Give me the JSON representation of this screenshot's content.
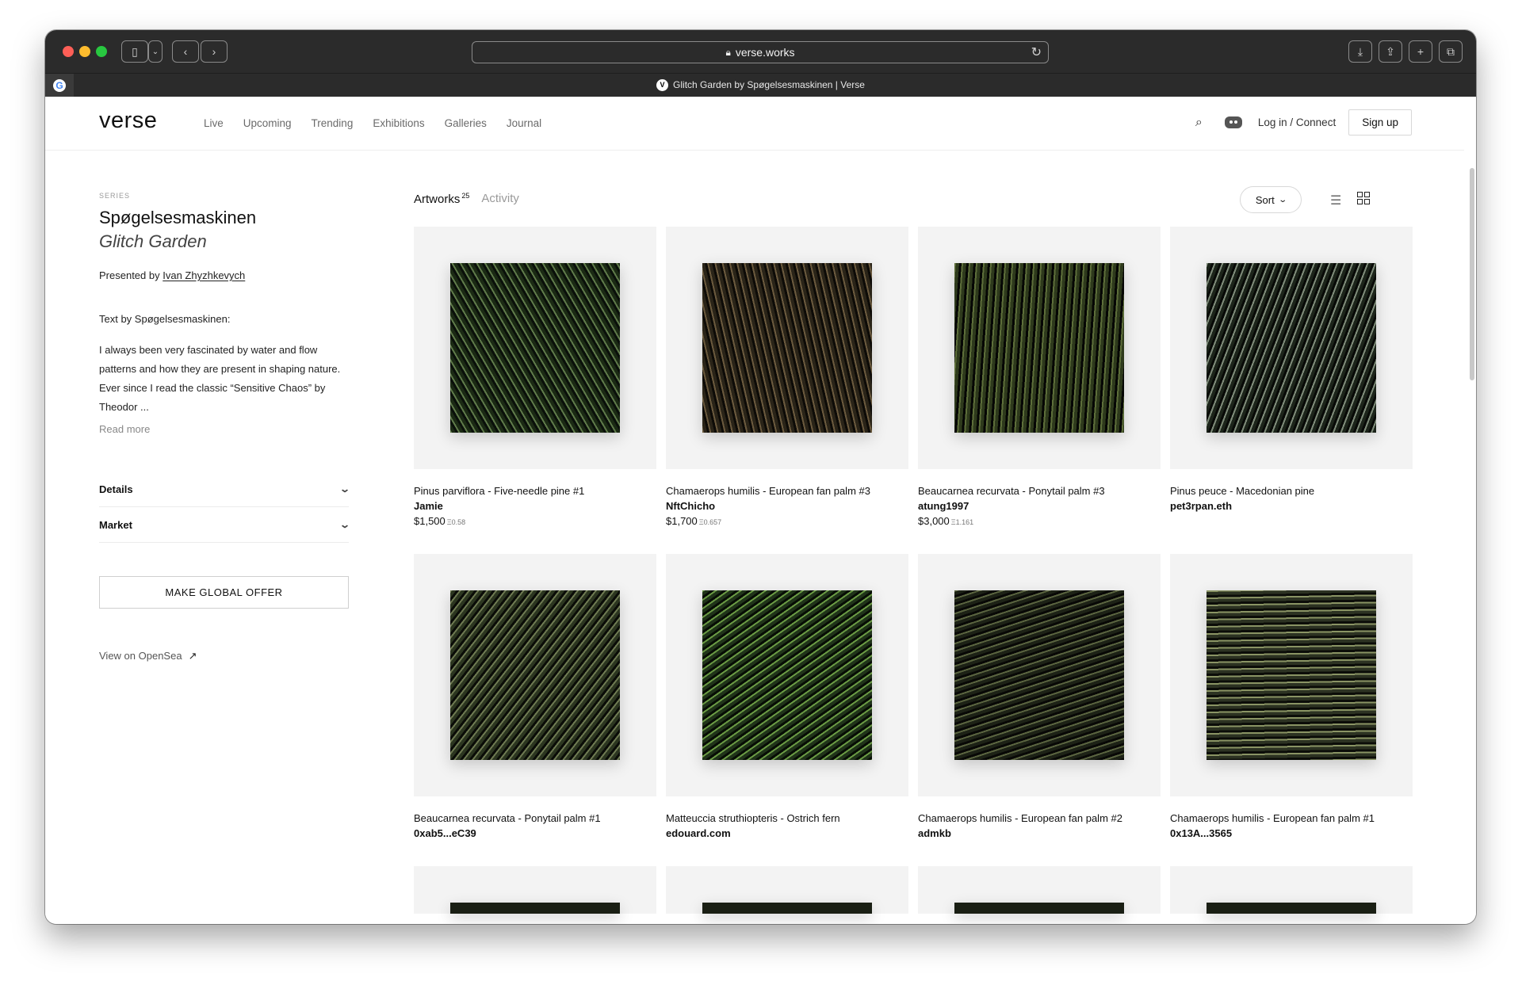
{
  "browser": {
    "url": "verse.works",
    "tab_title": "Glitch Garden by Spøgelsesmaskinen | Verse"
  },
  "nav": {
    "logo": "verse",
    "links": [
      "Live",
      "Upcoming",
      "Trending",
      "Exhibitions",
      "Galleries",
      "Journal"
    ],
    "login": "Log in / Connect",
    "signup": "Sign up"
  },
  "sidebar": {
    "label": "SERIES",
    "title": "Spøgelsesmaskinen",
    "subtitle": "Glitch Garden",
    "presented_prefix": "Presented by",
    "presenter": "Ivan Zhyzhkevych",
    "text_by": "Text by Spøgelsesmaskinen:",
    "description": "I always been very fascinated by water and flow patterns and how they are present in shaping nature. Ever since I read the classic “Sensitive Chaos” by Theodor ...",
    "read_more": "Read more",
    "details": "Details",
    "market": "Market",
    "offer_button": "MAKE GLOBAL OFFER",
    "opensea": "View on OpenSea"
  },
  "main": {
    "tab_artworks": "Artworks",
    "artworks_count": "25",
    "tab_activity": "Activity",
    "sort": "Sort",
    "artworks": [
      {
        "title": "Pinus parviflora - Five-needle pine #1",
        "owner": "Jamie",
        "price": "$1,500",
        "eth": "Ξ0.58",
        "colors": [
          "#1b2a14",
          "#5f7a4a",
          "#0a100a"
        ]
      },
      {
        "title": "Chamaerops humilis - European fan palm #3",
        "owner": "NftChicho",
        "price": "$1,700",
        "eth": "Ξ0.657",
        "colors": [
          "#2a2418",
          "#6b5a3e",
          "#0d0b07"
        ]
      },
      {
        "title": "Beaucarnea recurvata - Ponytail palm #3",
        "owner": "atung1997",
        "price": "$3,000",
        "eth": "Ξ1.161",
        "colors": [
          "#2e3a1c",
          "#5d6e3a",
          "#050604"
        ]
      },
      {
        "title": "Pinus peuce - Macedonian pine",
        "owner": "pet3rpan.eth",
        "price": "",
        "eth": "",
        "colors": [
          "#1c241a",
          "#7f8c7a",
          "#080a07"
        ]
      },
      {
        "title": "Beaucarnea recurvata - Ponytail palm #1",
        "owner": "0xab5...eC39",
        "price": "",
        "eth": "",
        "colors": [
          "#2c3620",
          "#6e7a52",
          "#0a0c07"
        ]
      },
      {
        "title": "Matteuccia struthiopteris - Ostrich fern",
        "owner": "edouard.com",
        "price": "",
        "eth": "",
        "colors": [
          "#203419",
          "#6a9a44",
          "#070d05"
        ]
      },
      {
        "title": "Chamaerops humilis - European fan palm #2",
        "owner": "admkb",
        "price": "",
        "eth": "",
        "colors": [
          "#1d2216",
          "#5a6440",
          "#080806"
        ]
      },
      {
        "title": "Chamaerops humilis - European fan palm #1",
        "owner": "0x13A...3565",
        "price": "",
        "eth": "",
        "colors": [
          "#2c3222",
          "#8a9464",
          "#0b0c08"
        ]
      }
    ]
  }
}
